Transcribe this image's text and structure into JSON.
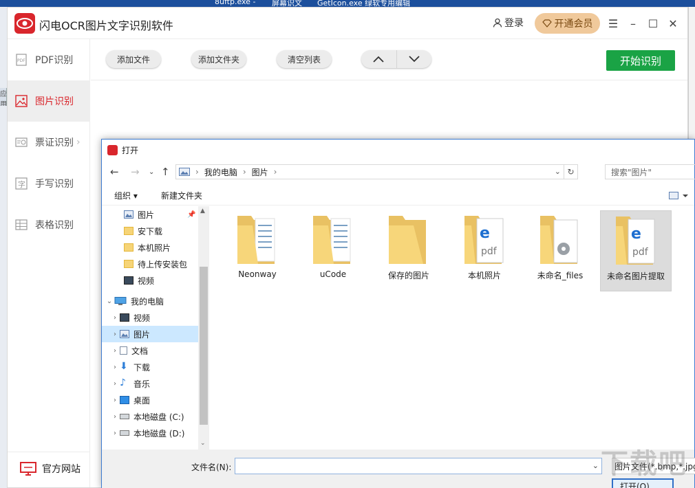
{
  "desktop": {
    "taskbar_items": [
      "8uftp.exe -",
      "屏幕识文",
      "GetIcon.exe  绿软专用编辑"
    ],
    "left_tab": "应用"
  },
  "app": {
    "title": "闪电OCR图片文字识别软件",
    "login_label": "登录",
    "vip_label": "开通会员",
    "accent": "#d9262c",
    "green": "#1aa345"
  },
  "sidebar": {
    "items": [
      {
        "label": "PDF识别",
        "icon": "pdf-icon"
      },
      {
        "label": "图片识别",
        "icon": "image-icon",
        "active": true
      },
      {
        "label": "票证识别",
        "icon": "ticket-icon"
      },
      {
        "label": "手写识别",
        "icon": "handwrite-icon"
      },
      {
        "label": "表格识别",
        "icon": "table-icon"
      }
    ],
    "official_site": "官方网站"
  },
  "toolbar": {
    "add_file": "添加文件",
    "add_folder": "添加文件夹",
    "clear_list": "清空列表",
    "start": "开始识别"
  },
  "dialog": {
    "title": "打开",
    "breadcrumb": [
      "我的电脑",
      "图片"
    ],
    "search_placeholder": "搜索\"图片\"",
    "organize": "组织 ▾",
    "new_folder": "新建文件夹",
    "tree": [
      {
        "label": "图片",
        "icon": "pictures-icon",
        "pinned": true
      },
      {
        "label": "安下载",
        "icon": "folder-icon"
      },
      {
        "label": "本机照片",
        "icon": "folder-icon"
      },
      {
        "label": "待上传安装包",
        "icon": "folder-icon"
      },
      {
        "label": "视频",
        "icon": "video-icon"
      },
      {
        "label": "我的电脑",
        "icon": "computer-icon",
        "expanded": true
      },
      {
        "label": "视频",
        "icon": "video-icon"
      },
      {
        "label": "图片",
        "icon": "pictures-icon",
        "selected": true
      },
      {
        "label": "文档",
        "icon": "document-icon"
      },
      {
        "label": "下载",
        "icon": "download-icon"
      },
      {
        "label": "音乐",
        "icon": "music-icon"
      },
      {
        "label": "桌面",
        "icon": "desktop-icon"
      },
      {
        "label": "本地磁盘 (C:)",
        "icon": "drive-icon"
      },
      {
        "label": "本地磁盘 (D:)",
        "icon": "drive-icon"
      }
    ],
    "files": [
      {
        "name": "Neonway",
        "kind": "docs"
      },
      {
        "name": "uCode",
        "kind": "docs"
      },
      {
        "name": "保存的图片",
        "kind": "empty"
      },
      {
        "name": "本机照片",
        "kind": "edge"
      },
      {
        "name": "未命名_files",
        "kind": "gear"
      },
      {
        "name": "未命名图片提取",
        "kind": "edge",
        "selected": true
      }
    ],
    "filename_label": "文件名(N):",
    "filename_value": "",
    "filetype": "图片文件(*.bmp,*.jpg,",
    "open_button": "打开(O)"
  },
  "watermark": "下载吧"
}
